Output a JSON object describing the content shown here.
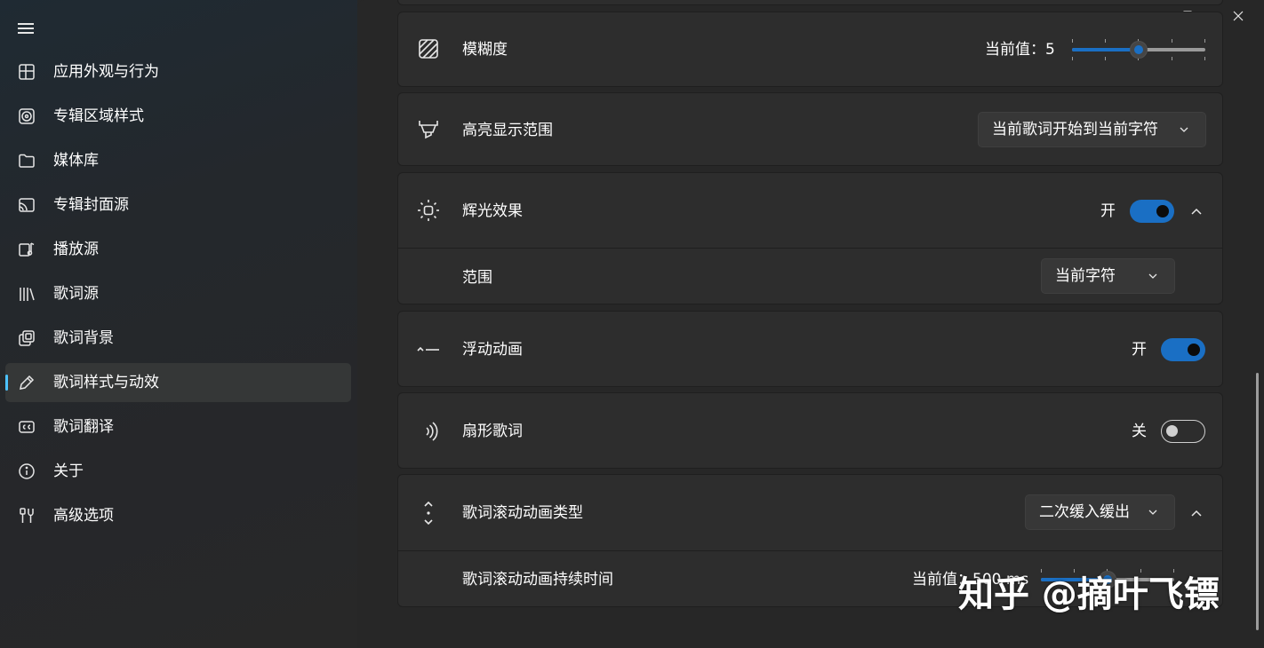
{
  "sidebar": {
    "items": [
      {
        "label": "应用外观与行为",
        "icon": "layout-icon"
      },
      {
        "label": "专辑区域样式",
        "icon": "album-icon"
      },
      {
        "label": "媒体库",
        "icon": "folder-icon"
      },
      {
        "label": "专辑封面源",
        "icon": "cover-source-icon"
      },
      {
        "label": "播放源",
        "icon": "music-source-icon"
      },
      {
        "label": "歌词源",
        "icon": "library-icon"
      },
      {
        "label": "歌词背景",
        "icon": "background-icon"
      },
      {
        "label": "歌词样式与动效",
        "icon": "pen-icon",
        "selected": true
      },
      {
        "label": "歌词翻译",
        "icon": "cc-icon"
      },
      {
        "label": "关于",
        "icon": "info-icon"
      },
      {
        "label": "高级选项",
        "icon": "tools-icon"
      }
    ]
  },
  "settings": {
    "blur": {
      "label": "模糊度",
      "value_text": "当前值：5",
      "value": 5,
      "min": 0,
      "max": 10
    },
    "highlight_range": {
      "label": "高亮显示范围",
      "selected": "当前歌词开始到当前字符"
    },
    "glow": {
      "label": "辉光效果",
      "state": "开",
      "on": true
    },
    "glow_range": {
      "label": "范围",
      "selected": "当前字符"
    },
    "float_anim": {
      "label": "浮动动画",
      "state": "开",
      "on": true
    },
    "fan_lyrics": {
      "label": "扇形歌词",
      "state": "关",
      "on": false
    },
    "scroll_type": {
      "label": "歌词滚动动画类型",
      "selected": "二次缓入缓出"
    },
    "scroll_duration": {
      "label": "歌词滚动动画持续时间",
      "value_text": "当前值：500 ms",
      "value": 500,
      "min": 0,
      "max": 1000
    }
  },
  "watermark": "知乎 @摘叶飞镖",
  "colors": {
    "accent": "#1a6fc4",
    "indicator": "#4cc2ff"
  }
}
